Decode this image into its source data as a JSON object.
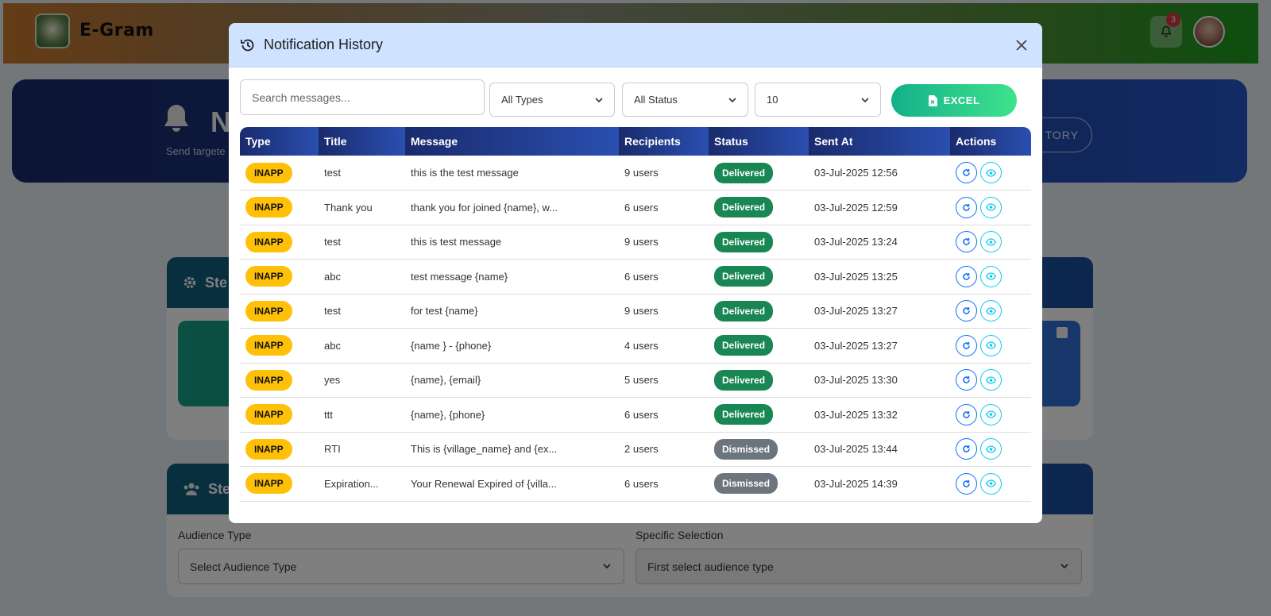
{
  "app": {
    "brand": "E-Gram",
    "notification_count": "3"
  },
  "hero": {
    "title_partial": "N",
    "subtitle_partial": "Send targete",
    "history_button_partial": "TORY"
  },
  "cards": {
    "step1_title_partial": "Ste",
    "step2_title_partial": "Ste",
    "audience_type_label": "Audience Type",
    "audience_type_value": "Select Audience Type",
    "specific_selection_label": "Specific Selection",
    "specific_selection_value": "First select audience type"
  },
  "modal": {
    "title": "Notification History",
    "search_placeholder": "Search messages...",
    "type_filter": "All Types",
    "status_filter": "All Status",
    "page_size": "10",
    "excel_label": "EXCEL",
    "columns": [
      "Type",
      "Title",
      "Message",
      "Recipients",
      "Status",
      "Sent At",
      "Actions"
    ],
    "rows": [
      {
        "type": "INAPP",
        "title": "test",
        "message": "this is the test message",
        "recipients": "9 users",
        "status": "Delivered",
        "sent_at": "03-Jul-2025 12:56"
      },
      {
        "type": "INAPP",
        "title": "Thank you",
        "message": "thank you for joined {name}, w...",
        "recipients": "6 users",
        "status": "Delivered",
        "sent_at": "03-Jul-2025 12:59"
      },
      {
        "type": "INAPP",
        "title": "test",
        "message": "this is test message",
        "recipients": "9 users",
        "status": "Delivered",
        "sent_at": "03-Jul-2025 13:24"
      },
      {
        "type": "INAPP",
        "title": "abc",
        "message": "test message {name}",
        "recipients": "6 users",
        "status": "Delivered",
        "sent_at": "03-Jul-2025 13:25"
      },
      {
        "type": "INAPP",
        "title": "test",
        "message": "for test {name}",
        "recipients": "9 users",
        "status": "Delivered",
        "sent_at": "03-Jul-2025 13:27"
      },
      {
        "type": "INAPP",
        "title": "abc",
        "message": "{name } - {phone}",
        "recipients": "4 users",
        "status": "Delivered",
        "sent_at": "03-Jul-2025 13:27"
      },
      {
        "type": "INAPP",
        "title": "yes",
        "message": "{name}, {email}",
        "recipients": "5 users",
        "status": "Delivered",
        "sent_at": "03-Jul-2025 13:30"
      },
      {
        "type": "INAPP",
        "title": "ttt",
        "message": "{name}, {phone}",
        "recipients": "6 users",
        "status": "Delivered",
        "sent_at": "03-Jul-2025 13:32"
      },
      {
        "type": "INAPP",
        "title": "RTI",
        "message": "This is {village_name} and {ex...",
        "recipients": "2 users",
        "status": "Dismissed",
        "sent_at": "03-Jul-2025 13:44"
      },
      {
        "type": "INAPP",
        "title": "Expiration...",
        "message": "Your Renewal Expired of {villa...",
        "recipients": "6 users",
        "status": "Dismissed",
        "sent_at": "03-Jul-2025 14:39"
      }
    ]
  },
  "colors": {
    "delivered": "#198754",
    "dismissed": "#6c757d",
    "type_badge": "#ffc107"
  },
  "icons": [
    "history-icon",
    "close-icon",
    "chevron-down-icon",
    "file-excel-icon",
    "redo-icon",
    "eye-icon",
    "bell-icon",
    "gear-icon",
    "users-icon"
  ]
}
